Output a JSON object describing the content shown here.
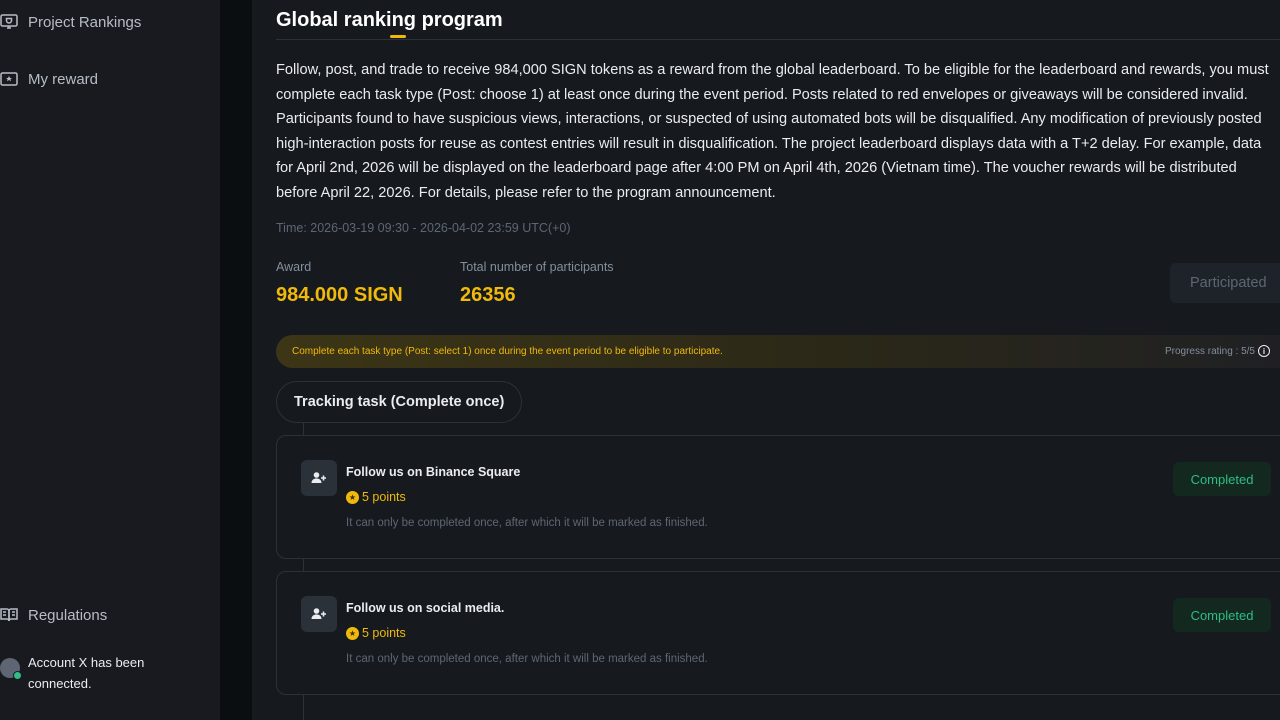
{
  "sidebar": {
    "items": [
      {
        "label": "Project Rankings",
        "icon": "trophy-icon"
      },
      {
        "label": "My reward",
        "icon": "ticket-icon"
      },
      {
        "label": "Regulations",
        "icon": "book-icon"
      }
    ],
    "account_text": "Account X has been connected."
  },
  "main": {
    "title": "Global ranking program",
    "description": "Follow, post, and trade to receive 984,000 SIGN tokens as a reward from the global leaderboard. To be eligible for the leaderboard and rewards, you must complete each task type (Post: choose 1) at least once during the event period. Posts related to red envelopes or giveaways will be considered invalid. Participants found to have suspicious views, interactions, or suspected of using automated bots will be disqualified. Any modification of previously posted high-interaction posts for reuse as contest entries will result in disqualification. The project leaderboard displays data with a T+2 delay. For example, data for April 2nd, 2026 will be displayed on the leaderboard page after 4:00 PM on April 4th, 2026 (Vietnam time). The voucher rewards will be distributed before April 22, 2026. For details, please refer to the program announcement.",
    "time": "Time: 2026-03-19 09:30 - 2026-04-02 23:59 UTC(+0)",
    "award_label": "Award",
    "award_value": "984.000 SIGN",
    "participants_label": "Total number of participants",
    "participants_value": "26356",
    "participated_label": "Participated",
    "banner_text": "Complete each task type (Post: select 1) once during the event period to be eligible to participate.",
    "progress_text": "Progress rating : 5/5",
    "tab_label": "Tracking task (Complete once)",
    "tasks": [
      {
        "title": "Follow us on Binance Square",
        "points": "5 points",
        "description": "It can only be completed once, after which it will be marked as finished.",
        "status": "Completed"
      },
      {
        "title": "Follow us on social media.",
        "points": "5 points",
        "description": "It can only be completed once, after which it will be marked as finished.",
        "status": "Completed"
      }
    ]
  },
  "colors": {
    "accent": "#f0b90b",
    "success": "#2ebd85",
    "background": "#161a1e",
    "sidebar": "#181a20"
  }
}
